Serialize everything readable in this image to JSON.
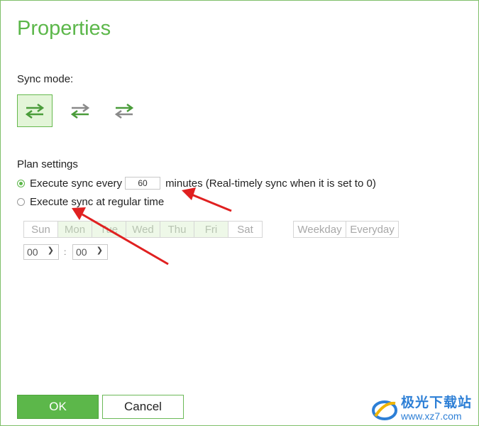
{
  "dialog": {
    "title": "Properties"
  },
  "sync_mode": {
    "label": "Sync mode:",
    "modes": [
      {
        "icon": "two-way-sync-icon",
        "selected": true
      },
      {
        "icon": "one-way-sync-icon",
        "selected": false
      },
      {
        "icon": "mirror-sync-icon",
        "selected": false
      }
    ]
  },
  "plan": {
    "label": "Plan settings",
    "option_interval": {
      "prefix": "Execute sync every",
      "value": "60",
      "suffix": "minutes (Real-timely sync when it is set to 0)",
      "checked": true
    },
    "option_regular": {
      "label": "Execute sync at regular time",
      "checked": false
    },
    "days": [
      {
        "label": "Sun",
        "selected": false
      },
      {
        "label": "Mon",
        "selected": true
      },
      {
        "label": "Tue",
        "selected": true
      },
      {
        "label": "Wed",
        "selected": true
      },
      {
        "label": "Thu",
        "selected": true
      },
      {
        "label": "Fri",
        "selected": true
      },
      {
        "label": "Sat",
        "selected": false
      }
    ],
    "quick": {
      "weekday": "Weekday",
      "everyday": "Everyday"
    },
    "hour": "00",
    "minute": "00",
    "time_separator": ":"
  },
  "buttons": {
    "ok": "OK",
    "cancel": "Cancel"
  },
  "watermark": {
    "name": "极光下载站",
    "url": "www.xz7.com"
  },
  "colors": {
    "accent": "#5cb74a",
    "arrow": "#e02020"
  }
}
